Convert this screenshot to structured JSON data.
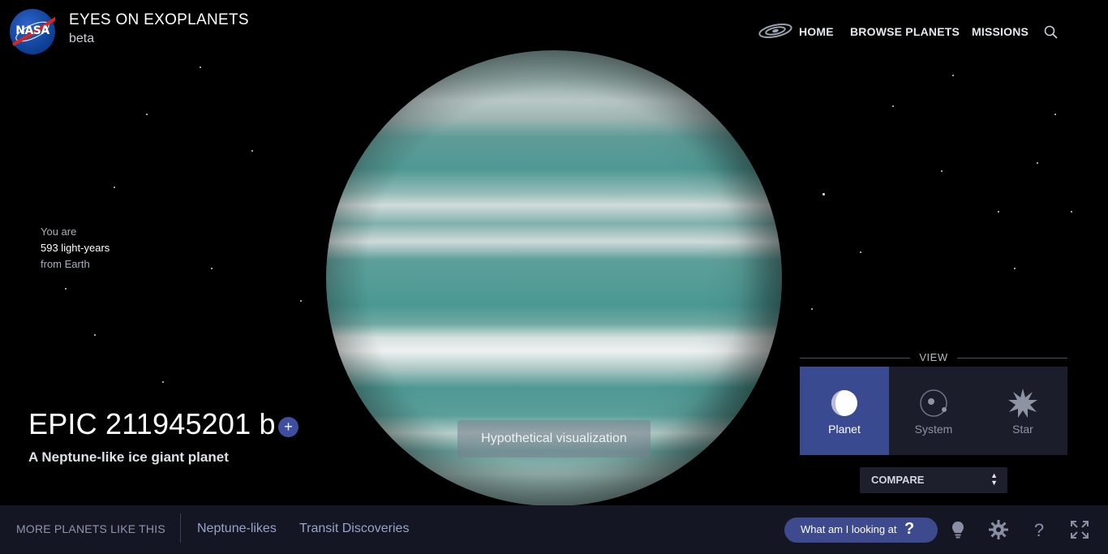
{
  "header": {
    "logo_text": "NASA",
    "app_title": "EYES ON EXOPLANETS",
    "app_subtitle": "beta",
    "nav": {
      "home": "HOME",
      "browse": "BROWSE PLANETS",
      "missions": "MISSIONS",
      "search_icon": "search-icon",
      "home_icon": "galaxy-icon"
    }
  },
  "distance": {
    "line1": "You are",
    "line2": "593 light-years",
    "line3": "from Earth"
  },
  "planet": {
    "name": "EPIC 211945201 b",
    "add_label": "+",
    "description": "A Neptune-like ice giant planet",
    "visualization_note": "Hypothetical visualization"
  },
  "view_panel": {
    "title": "VIEW",
    "buttons": [
      {
        "label": "Planet",
        "icon": "planet-icon",
        "active": true
      },
      {
        "label": "System",
        "icon": "system-icon",
        "active": false
      },
      {
        "label": "Star",
        "icon": "star-icon",
        "active": false
      }
    ],
    "compare": {
      "label": "COMPARE"
    }
  },
  "bottom_bar": {
    "more_label": "MORE PLANETS LIKE THIS",
    "links": [
      "Neptune-likes",
      "Transit Discoveries"
    ],
    "looking_button": "What am I looking at",
    "looking_q": "?",
    "icons": [
      "lightbulb-icon",
      "gear-icon",
      "help-icon",
      "fullscreen-icon"
    ]
  },
  "colors": {
    "accent": "#3d4a8e",
    "active_view": "#3a4a90",
    "bottom_bar": "#151623",
    "planet_teal": "#4f9893"
  }
}
